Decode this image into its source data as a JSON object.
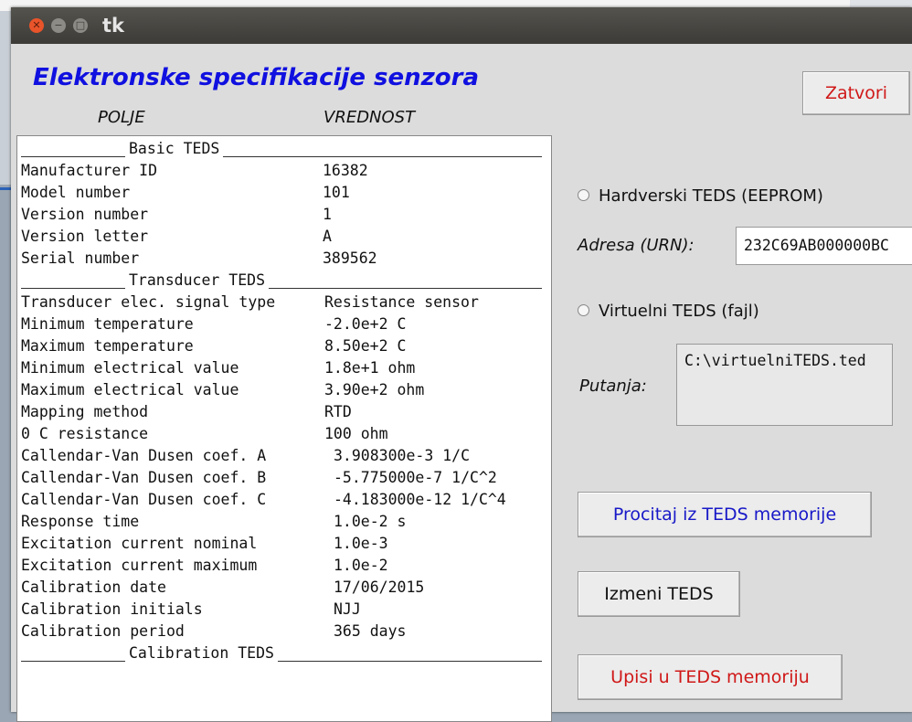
{
  "window": {
    "title": "tk",
    "controls": {
      "close": "✕",
      "minimize": "−",
      "maximize": "□"
    }
  },
  "heading": "Elektronske specifikacije senzora",
  "columns": {
    "field": "POLJE",
    "value": "VREDNOST"
  },
  "list": {
    "sections": [
      {
        "label": "Basic TEDS"
      },
      {
        "label": "Transducer TEDS"
      },
      {
        "label": "Calibration TEDS"
      }
    ],
    "basic": [
      {
        "key": "Manufacturer ID",
        "value": "16382"
      },
      {
        "key": "Model number",
        "value": "101"
      },
      {
        "key": "Version number",
        "value": "1"
      },
      {
        "key": "Version letter",
        "value": "A"
      },
      {
        "key": "Serial number",
        "value": "389562"
      }
    ],
    "transducer": [
      {
        "key": "Transducer elec. signal type",
        "value": "Resistance sensor"
      },
      {
        "key": "Minimum temperature",
        "value": "-2.0e+2 C"
      },
      {
        "key": "Maximum temperature",
        "value": "8.50e+2 C"
      },
      {
        "key": "Minimum electrical value",
        "value": "1.8e+1 ohm"
      },
      {
        "key": "Maximum electrical value",
        "value": "3.90e+2 ohm"
      },
      {
        "key": "Mapping method",
        "value": "RTD"
      },
      {
        "key": "0 C resistance",
        "value": "100 ohm"
      },
      {
        "key": "Callendar-Van Dusen coef. A",
        "value": "3.908300e-3 1/C"
      },
      {
        "key": "Callendar-Van Dusen coef. B",
        "value": "-5.775000e-7 1/C^2"
      },
      {
        "key": "Callendar-Van Dusen coef. C",
        "value": "-4.183000e-12 1/C^4"
      },
      {
        "key": "Response time",
        "value": "1.0e-2 s"
      },
      {
        "key": "Excitation current nominal",
        "value": "1.0e-3"
      },
      {
        "key": "Excitation current maximum",
        "value": "1.0e-2"
      },
      {
        "key": "Calibration date",
        "value": "17/06/2015"
      },
      {
        "key": "Calibration initials",
        "value": "NJJ"
      },
      {
        "key": "Calibration period",
        "value": "365 days"
      }
    ]
  },
  "buttons": {
    "close": "Zatvori",
    "read": "Procitaj iz TEDS memorije",
    "edit": "Izmeni TEDS",
    "write": "Upisi u TEDS memoriju"
  },
  "hardware": {
    "radio_label": "Hardverski TEDS (EEPROM)",
    "address_label": "Adresa (URN):",
    "address_value": "232C69AB000000BC"
  },
  "virtual": {
    "radio_label": "Virtuelni TEDS (fajl)",
    "path_label": "Putanja:",
    "path_value": "C:\\virtuelniTEDS.ted"
  },
  "colors": {
    "heading": "#1010e0",
    "danger": "#d01818",
    "accent": "#1818c8"
  }
}
